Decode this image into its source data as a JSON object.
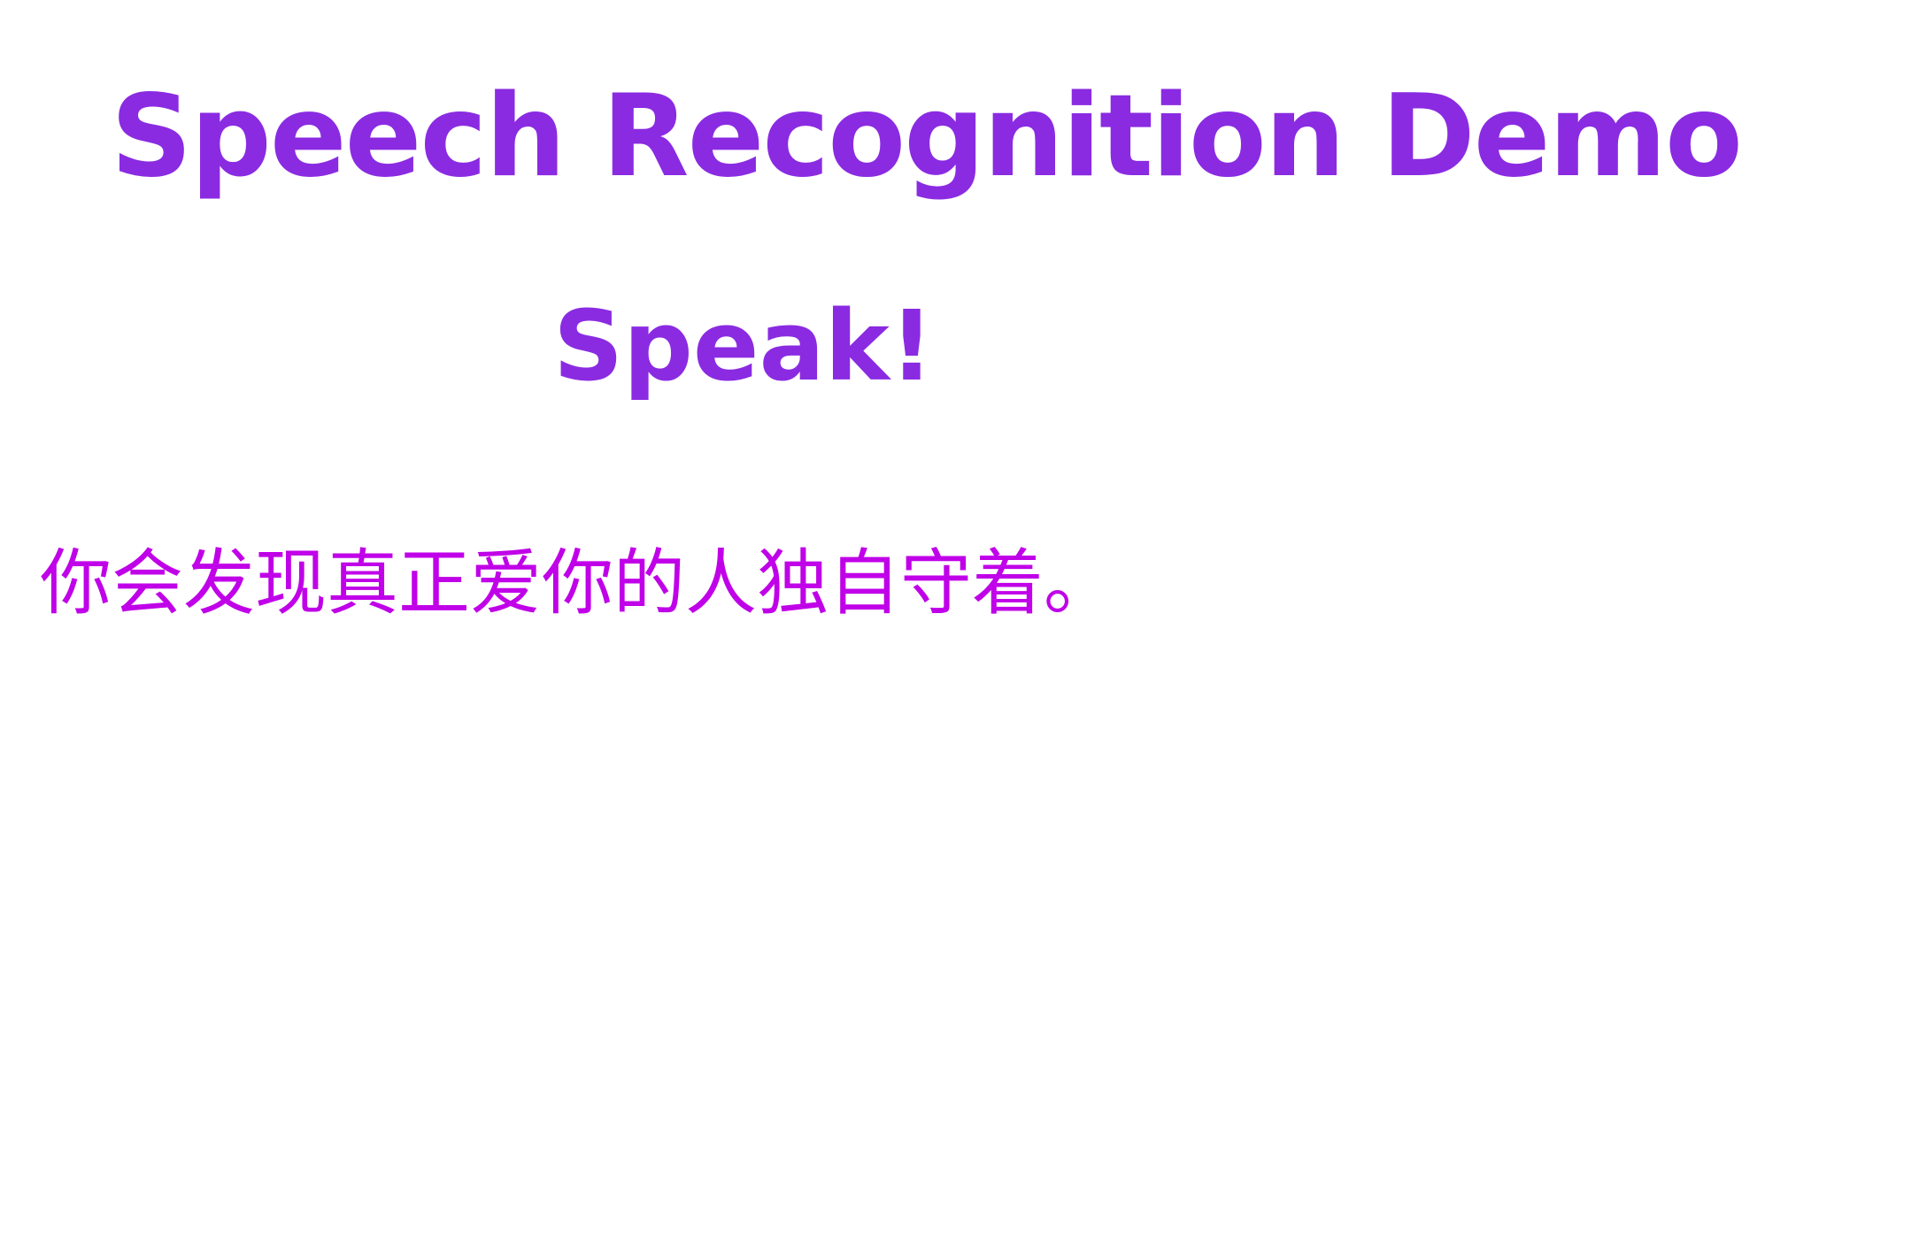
{
  "page": {
    "title": "Speech Recognition Demo"
  },
  "speak_button": {
    "label": "Speak!"
  },
  "transcript": {
    "text": "你会发现真正爱你的人独自守着。"
  },
  "colors": {
    "title": "#8a2be2",
    "speak": "#8a2be2",
    "transcript": "#c000e8",
    "background": "#ffffff"
  }
}
